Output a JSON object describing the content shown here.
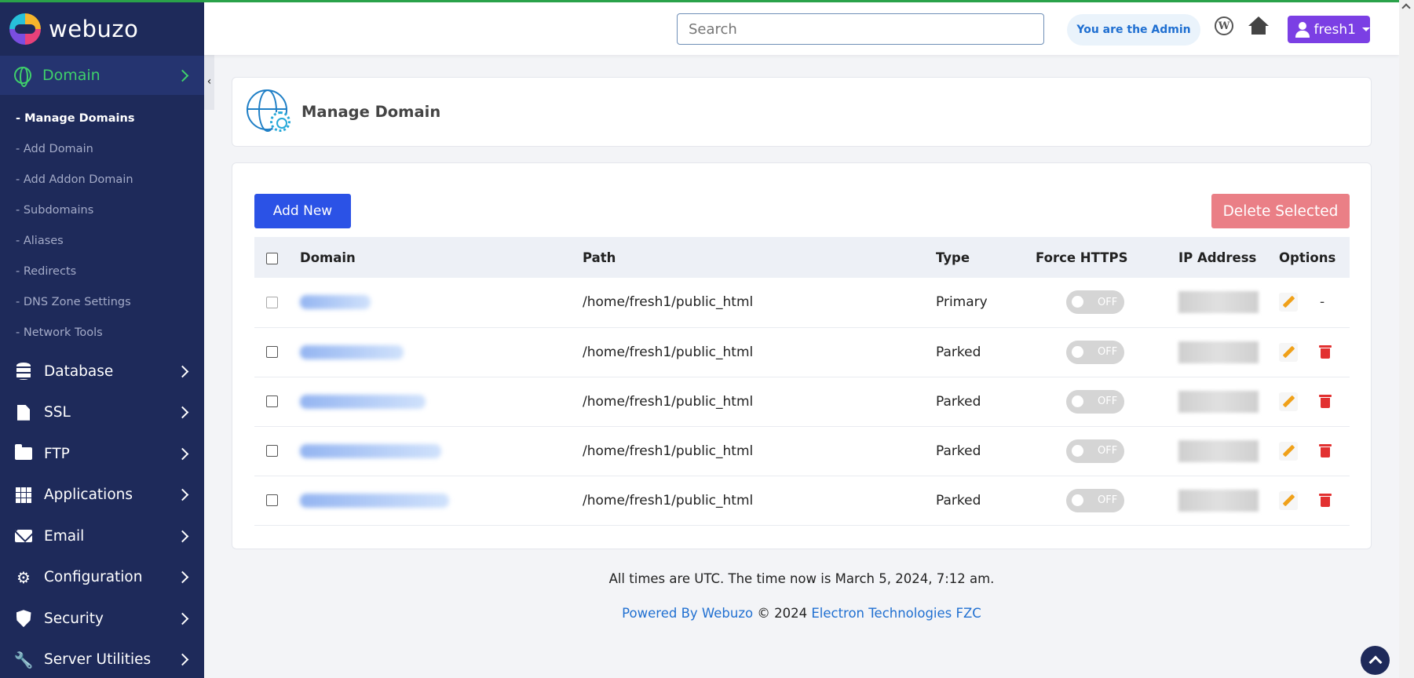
{
  "brand": {
    "name": "webuzo"
  },
  "search": {
    "placeholder": "Search"
  },
  "header": {
    "admin_badge": "You are the Admin",
    "user_name": "fresh1"
  },
  "sidebar": {
    "active": {
      "label": "Domain"
    },
    "submenu": [
      "- Manage Domains",
      "- Add Domain",
      "- Add Addon Domain",
      "- Subdomains",
      "- Aliases",
      "- Redirects",
      "- DNS Zone Settings",
      "- Network Tools"
    ],
    "items": [
      {
        "label": "Database",
        "icon": "database-icon"
      },
      {
        "label": "SSL",
        "icon": "file-icon"
      },
      {
        "label": "FTP",
        "icon": "folder-icon"
      },
      {
        "label": "Applications",
        "icon": "grid-icon"
      },
      {
        "label": "Email",
        "icon": "envelope-icon"
      },
      {
        "label": "Configuration",
        "icon": "gears-icon"
      },
      {
        "label": "Security",
        "icon": "shield-icon"
      },
      {
        "label": "Server Utilities",
        "icon": "wrench-icon"
      }
    ]
  },
  "page": {
    "title": "Manage Domain"
  },
  "actions": {
    "add_new": "Add New",
    "delete_selected": "Delete Selected"
  },
  "table": {
    "headers": {
      "domain": "Domain",
      "path": "Path",
      "type": "Type",
      "force_https": "Force HTTPS",
      "ip": "IP Address",
      "options": "Options"
    },
    "rows": [
      {
        "path": "/home/fresh1/public_html",
        "type": "Primary",
        "https": "OFF",
        "delete": "-"
      },
      {
        "path": "/home/fresh1/public_html",
        "type": "Parked",
        "https": "OFF"
      },
      {
        "path": "/home/fresh1/public_html",
        "type": "Parked",
        "https": "OFF"
      },
      {
        "path": "/home/fresh1/public_html",
        "type": "Parked",
        "https": "OFF"
      },
      {
        "path": "/home/fresh1/public_html",
        "type": "Parked",
        "https": "OFF"
      }
    ]
  },
  "footer": {
    "time": "All times are UTC. The time now is March 5, 2024, 7:12 am.",
    "powered_by": "Powered By Webuzo",
    "copyright": "© 2024",
    "company": "Electron Technologies FZC"
  },
  "colors": {
    "sidebar": "#1e2a5a",
    "accent_green": "#3fd06b",
    "primary": "#2b52e6",
    "danger": "#ea7f86",
    "user": "#7b3fe4"
  }
}
